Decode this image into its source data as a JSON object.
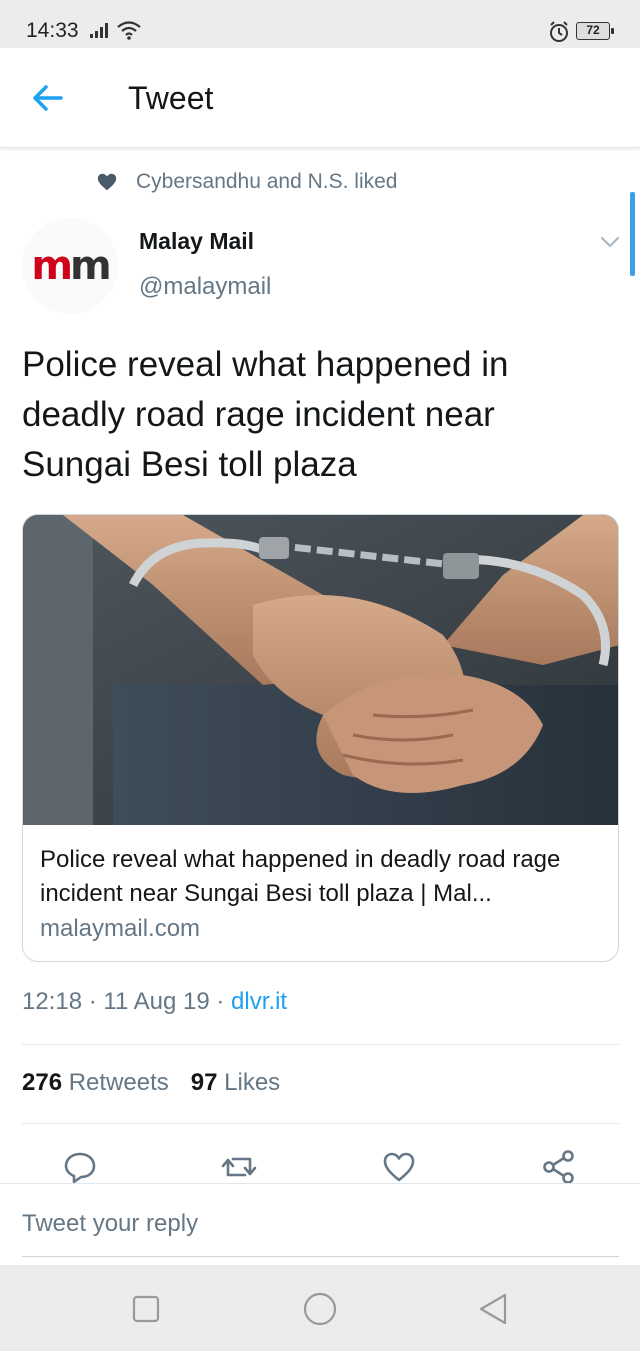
{
  "status_bar": {
    "time": "14:33",
    "battery": "72",
    "icons": [
      "signal-icon",
      "wifi-icon",
      "alarm-icon",
      "battery-icon"
    ]
  },
  "header": {
    "title": "Tweet",
    "back_icon": "arrow-left-icon"
  },
  "social_context": {
    "icon": "heart-icon",
    "text": "Cybersandhu and N.S. liked"
  },
  "author": {
    "avatar_text_a": "m",
    "avatar_text_b": "m",
    "name": "Malay Mail",
    "handle": "@malaymail"
  },
  "tweet": {
    "text": "Police reveal what happened in deadly road rage incident near Sungai Besi toll plaza"
  },
  "link_card": {
    "image_description_icon": "handcuffs-photo",
    "title": "Police reveal what happened in deadly road rage incident near Sungai Besi toll plaza | Mal...",
    "domain": "malaymail.com"
  },
  "meta": {
    "time": "12:18",
    "sep1": " · ",
    "date": "11 Aug 19",
    "sep2": " · ",
    "source": "dlvr.it"
  },
  "stats": {
    "retweets_count": "276",
    "retweets_label": " Retweets",
    "likes_count": "97",
    "likes_label": " Likes"
  },
  "actions": [
    "reply-icon",
    "retweet-icon",
    "like-icon",
    "share-icon"
  ],
  "reply": {
    "placeholder": "Tweet your reply"
  },
  "colors": {
    "accent": "#1da1f2",
    "secondary_text": "#657786",
    "brand_red": "#d0021b"
  }
}
